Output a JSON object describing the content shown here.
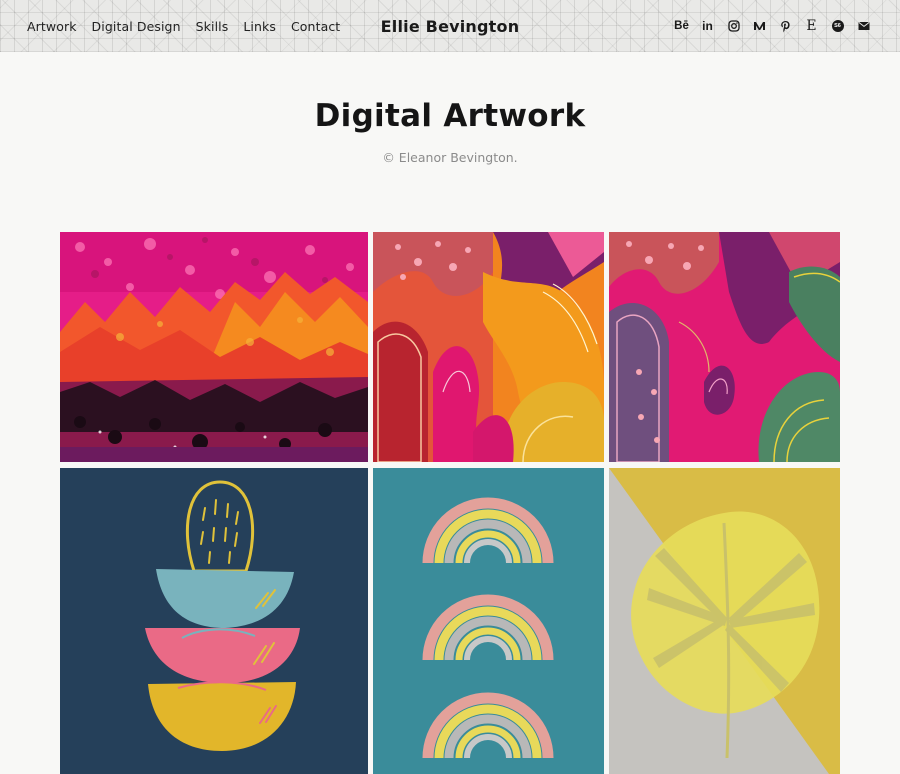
{
  "header": {
    "nav": [
      {
        "label": "Artwork"
      },
      {
        "label": "Digital Design"
      },
      {
        "label": "Skills"
      },
      {
        "label": "Links"
      },
      {
        "label": "Contact"
      }
    ],
    "site_title": "Ellie Bevington",
    "social_icons": [
      "behance-icon",
      "linkedin-icon",
      "instagram-icon",
      "medium-icon",
      "pinterest-icon",
      "etsy-icon",
      "society6-icon",
      "email-icon"
    ],
    "behance_glyph": "Bē",
    "linkedin_glyph": "in",
    "etsy_glyph": "E",
    "society6_glyph": "S6"
  },
  "main": {
    "title": "Digital Artwork",
    "subtitle": "© Eleanor Bevington."
  },
  "gallery": {
    "items": [
      {
        "name": "pink-orange-abstract-texture"
      },
      {
        "name": "warm-abstract-shapes"
      },
      {
        "name": "pink-green-abstract-shapes"
      },
      {
        "name": "stacked-bowls-illustration"
      },
      {
        "name": "rainbows-illustration"
      },
      {
        "name": "monstera-leaf-illustration"
      }
    ]
  },
  "colors": {
    "background": "#f8f8f6",
    "text": "#1a1a1a",
    "subtitle": "#8b8b8b",
    "navy": "#25405a",
    "teal": "#3a8c9a",
    "magenta": "#e0176f",
    "orange": "#f2841f",
    "yellow": "#e8d23c"
  }
}
